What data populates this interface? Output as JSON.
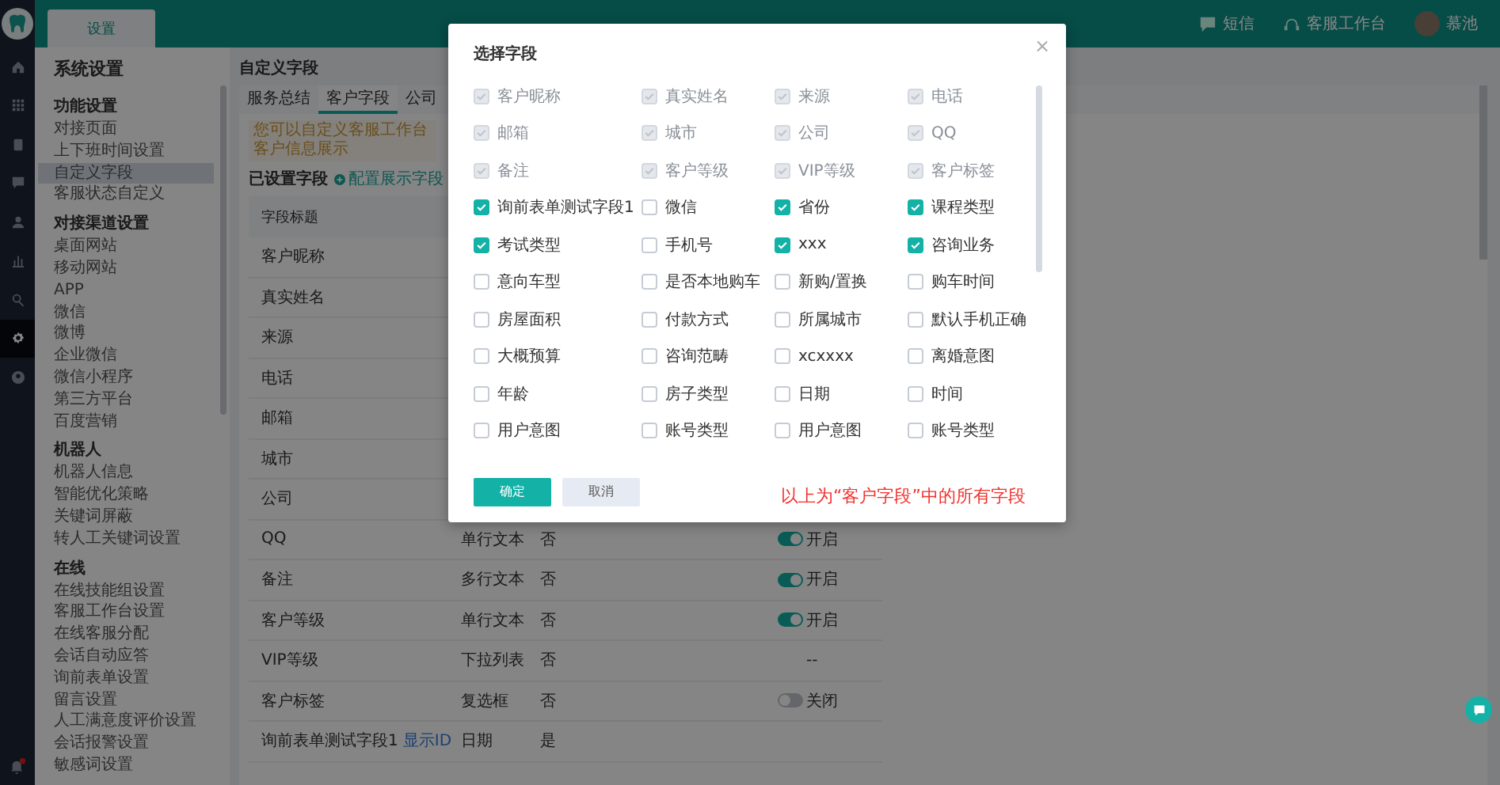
{
  "topbar": {
    "tabs": [
      {
        "label": "设置",
        "selected": true
      }
    ],
    "actions": [
      {
        "label": "短信"
      },
      {
        "label": "客服工作台"
      }
    ],
    "user": {
      "name": "慕池"
    }
  },
  "rail": {
    "items": [
      {
        "selected": false
      },
      {
        "selected": false
      },
      {
        "selected": false
      },
      {
        "selected": false
      },
      {
        "selected": false
      },
      {
        "selected": false
      },
      {
        "selected": false
      },
      {
        "selected": true
      },
      {
        "selected": false
      }
    ],
    "notification": true
  },
  "sidebar": {
    "title": "系统设置",
    "groups": [
      {
        "heading": "功能设置",
        "items": [
          {
            "label": "对接页面",
            "selected": false
          },
          {
            "label": "上下班时间设置",
            "selected": false
          },
          {
            "label": "自定义字段",
            "selected": true
          },
          {
            "label": "客服状态自定义",
            "selected": false
          }
        ]
      },
      {
        "heading": "对接渠道设置",
        "items": [
          {
            "label": "桌面网站",
            "selected": false
          },
          {
            "label": "移动网站",
            "selected": false
          },
          {
            "label": "APP",
            "selected": false
          },
          {
            "label": "微信",
            "selected": false
          },
          {
            "label": "微博",
            "selected": false
          },
          {
            "label": "企业微信",
            "selected": false
          },
          {
            "label": "微信小程序",
            "selected": false
          },
          {
            "label": "第三方平台",
            "selected": false
          },
          {
            "label": "百度营销",
            "selected": false
          }
        ]
      },
      {
        "heading": "机器人",
        "items": [
          {
            "label": "机器人信息",
            "selected": false
          },
          {
            "label": "智能优化策略",
            "selected": false
          },
          {
            "label": "关键词屏蔽",
            "selected": false
          },
          {
            "label": "转人工关键词设置",
            "selected": false
          }
        ]
      },
      {
        "heading": "在线",
        "items": [
          {
            "label": "在线技能组设置",
            "selected": false
          },
          {
            "label": "客服工作台设置",
            "selected": false
          },
          {
            "label": "在线客服分配",
            "selected": false
          },
          {
            "label": "会话自动应答",
            "selected": false
          },
          {
            "label": "询前表单设置",
            "selected": false
          },
          {
            "label": "留言设置",
            "selected": false
          },
          {
            "label": "人工满意度评价设置",
            "selected": false
          },
          {
            "label": "会话报警设置",
            "selected": false
          },
          {
            "label": "敏感词设置",
            "selected": false
          }
        ]
      }
    ]
  },
  "main": {
    "title": "自定义字段",
    "tabs": [
      {
        "label": "服务总结",
        "selected": false
      },
      {
        "label": "客户字段",
        "selected": true
      },
      {
        "label": "公司",
        "selected": false
      }
    ],
    "notice": "您可以自定义客服工作台客户信息展示",
    "section_title": "已设置字段",
    "config_link": "配置展示字段",
    "table": {
      "columns": [
        "字段标题"
      ],
      "rows": [
        {
          "title": "客户昵称"
        },
        {
          "title": "真实姓名"
        },
        {
          "title": "来源"
        },
        {
          "title": "电话"
        },
        {
          "title": "邮箱"
        },
        {
          "title": "城市"
        },
        {
          "title": "公司"
        },
        {
          "title": "QQ",
          "type": "单行文本",
          "required": "否",
          "display": {
            "kind": "toggle",
            "on": true,
            "label": "开启"
          }
        },
        {
          "title": "备注",
          "type": "多行文本",
          "required": "否",
          "display": {
            "kind": "toggle",
            "on": true,
            "label": "开启"
          }
        },
        {
          "title": "客户等级",
          "type": "单行文本",
          "required": "否",
          "display": {
            "kind": "toggle",
            "on": true,
            "label": "开启"
          }
        },
        {
          "title": "VIP等级",
          "type": "下拉列表",
          "required": "否",
          "display": {
            "kind": "text",
            "text": "--"
          }
        },
        {
          "title": "客户标签",
          "type": "复选框",
          "required": "否",
          "display": {
            "kind": "toggle",
            "on": false,
            "label": "关闭"
          }
        },
        {
          "title": "询前表单测试字段1",
          "link": "显示ID",
          "type": "日期",
          "required": "是"
        }
      ]
    }
  },
  "modal": {
    "title": "选择字段",
    "close": "×",
    "fields": [
      {
        "label": "客户昵称",
        "checked": true,
        "disabled": true
      },
      {
        "label": "真实姓名",
        "checked": true,
        "disabled": true
      },
      {
        "label": "来源",
        "checked": true,
        "disabled": true
      },
      {
        "label": "电话",
        "checked": true,
        "disabled": true
      },
      {
        "label": "邮箱",
        "checked": true,
        "disabled": true
      },
      {
        "label": "城市",
        "checked": true,
        "disabled": true
      },
      {
        "label": "公司",
        "checked": true,
        "disabled": true
      },
      {
        "label": "QQ",
        "checked": true,
        "disabled": true
      },
      {
        "label": "备注",
        "checked": true,
        "disabled": true
      },
      {
        "label": "客户等级",
        "checked": true,
        "disabled": true
      },
      {
        "label": "VIP等级",
        "checked": true,
        "disabled": true
      },
      {
        "label": "客户标签",
        "checked": true,
        "disabled": true
      },
      {
        "label": "询前表单测试字段1",
        "checked": true,
        "disabled": false
      },
      {
        "label": "微信",
        "checked": false,
        "disabled": false
      },
      {
        "label": "省份",
        "checked": true,
        "disabled": false
      },
      {
        "label": "课程类型",
        "checked": true,
        "disabled": false
      },
      {
        "label": "考试类型",
        "checked": true,
        "disabled": false
      },
      {
        "label": "手机号",
        "checked": false,
        "disabled": false
      },
      {
        "label": "xxx",
        "checked": true,
        "disabled": false
      },
      {
        "label": "咨询业务",
        "checked": true,
        "disabled": false
      },
      {
        "label": "意向车型",
        "checked": false,
        "disabled": false
      },
      {
        "label": "是否本地购车",
        "checked": false,
        "disabled": false
      },
      {
        "label": "新购/置换",
        "checked": false,
        "disabled": false
      },
      {
        "label": "购车时间",
        "checked": false,
        "disabled": false
      },
      {
        "label": "房屋面积",
        "checked": false,
        "disabled": false
      },
      {
        "label": "付款方式",
        "checked": false,
        "disabled": false
      },
      {
        "label": "所属城市",
        "checked": false,
        "disabled": false
      },
      {
        "label": "默认手机正确",
        "checked": false,
        "disabled": false
      },
      {
        "label": "大概预算",
        "checked": false,
        "disabled": false
      },
      {
        "label": "咨询范畴",
        "checked": false,
        "disabled": false
      },
      {
        "label": "xcxxxx",
        "checked": false,
        "disabled": false
      },
      {
        "label": "离婚意图",
        "checked": false,
        "disabled": false
      },
      {
        "label": "年龄",
        "checked": false,
        "disabled": false
      },
      {
        "label": "房子类型",
        "checked": false,
        "disabled": false
      },
      {
        "label": "日期",
        "checked": false,
        "disabled": false
      },
      {
        "label": "时间",
        "checked": false,
        "disabled": false
      },
      {
        "label": "用户意图",
        "checked": false,
        "disabled": false
      },
      {
        "label": "账号类型",
        "checked": false,
        "disabled": false
      },
      {
        "label": "用户意图",
        "checked": false,
        "disabled": false
      },
      {
        "label": "账号类型",
        "checked": false,
        "disabled": false
      }
    ],
    "buttons": [
      {
        "label": "确定",
        "kind": "primary"
      },
      {
        "label": "取消",
        "kind": "secondary"
      }
    ],
    "note": "以上为“客户字段”中的所有字段"
  }
}
